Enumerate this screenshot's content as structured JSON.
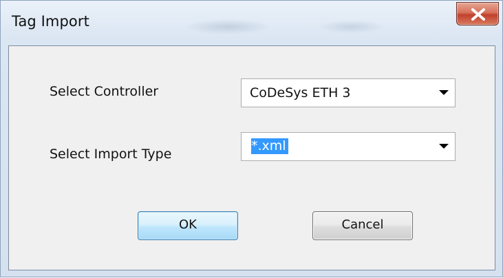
{
  "window": {
    "title": "Tag Import"
  },
  "form": {
    "controller_label": "Select Controller",
    "controller_value": "CoDeSys ETH 3",
    "import_type_label": "Select Import Type",
    "import_type_value": "*.xml"
  },
  "buttons": {
    "ok_label": "OK",
    "cancel_label": "Cancel"
  },
  "icons": {
    "close": "close-icon",
    "dropdown": "chevron-down-icon"
  },
  "colors": {
    "selection": "#3399ff",
    "close_button": "#c0412c",
    "dialog_background": "#f0f0f0"
  }
}
